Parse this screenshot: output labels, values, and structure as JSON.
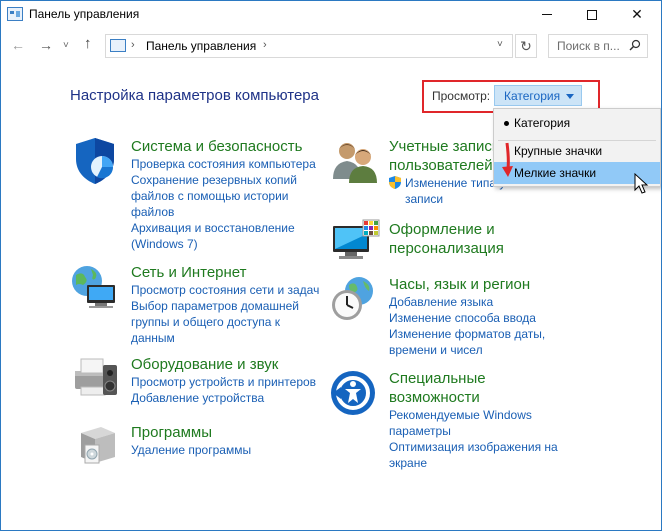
{
  "window": {
    "title": "Панель управления"
  },
  "navbar": {
    "address_path": "Панель управления",
    "search_placeholder": "Поиск в п..."
  },
  "main": {
    "heading": "Настройка параметров компьютера",
    "view_label": "Просмотр:",
    "view_selected": "Категория",
    "view_options": [
      {
        "label": "Категория",
        "selected": true
      },
      {
        "label": "Крупные значки",
        "selected": false
      },
      {
        "label": "Мелкие значки",
        "selected": false,
        "hovered": true
      }
    ]
  },
  "categories_left": [
    {
      "title": "Система и безопасность",
      "icon": "shield-chart-icon",
      "links": [
        "Проверка состояния компьютера",
        "Сохранение резервных копий",
        "файлов с помощью истории",
        "файлов",
        "Архивация и восстановление",
        "(Windows 7)"
      ]
    },
    {
      "title": "Сеть и Интернет",
      "icon": "network-globe-icon",
      "links": [
        "Просмотр состояния сети и задач",
        "Выбор параметров домашней",
        "группы и общего доступа к",
        "данным"
      ]
    },
    {
      "title": "Оборудование и звук",
      "icon": "printer-speaker-icon",
      "links": [
        "Просмотр устройств и принтеров",
        "Добавление устройства"
      ]
    },
    {
      "title": "Программы",
      "icon": "programs-box-icon",
      "links": [
        "Удаление программы"
      ]
    }
  ],
  "categories_right": [
    {
      "title_lines": [
        "Учетные записи",
        "пользователей"
      ],
      "icon": "users-icon",
      "links": [
        "Изменение типа учетной",
        "записи"
      ]
    },
    {
      "title_lines": [
        "Оформление и",
        "персонализация"
      ],
      "icon": "monitor-palette-icon",
      "links": []
    },
    {
      "title_lines": [
        "Часы, язык и регион"
      ],
      "icon": "clock-globe-icon",
      "links": [
        "Добавление языка",
        "Изменение способа ввода",
        "Изменение форматов даты,",
        "времени и чисел"
      ]
    },
    {
      "title_lines": [
        "Специальные",
        "возможности"
      ],
      "icon": "accessibility-icon",
      "links": [
        "Рекомендуемые Windows",
        "параметры",
        "Оптимизация изображения на",
        "экране"
      ]
    }
  ],
  "colors": {
    "category_title": "#1f7a1f",
    "link": "#1a5fb4",
    "heading": "#1e3287",
    "highlight_box": "#e0262a",
    "hover": "#91c9f7"
  }
}
